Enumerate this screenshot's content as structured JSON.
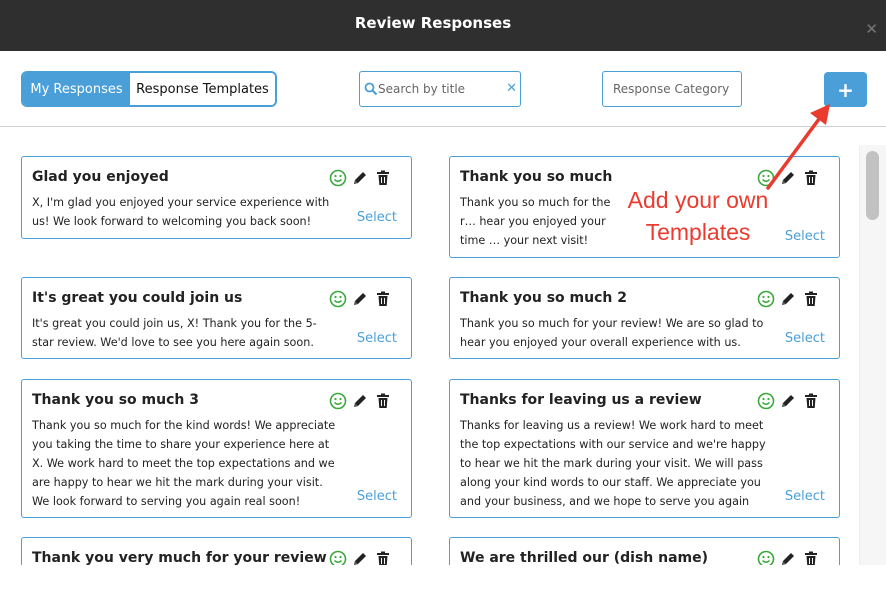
{
  "window": {
    "title": "Review Responses",
    "close_icon": "close-icon"
  },
  "toolbar": {
    "tabs": [
      {
        "label": "My Responses",
        "active": true
      },
      {
        "label": "Response Templates",
        "active": false
      }
    ],
    "search": {
      "placeholder": "Search by title",
      "value": ""
    },
    "category": {
      "placeholder": "Response Category"
    },
    "add_button": {
      "label": "+"
    }
  },
  "cards": [
    {
      "title": "Glad you enjoyed",
      "body": "X, I'm glad you enjoyed your service experience with us! We look forward to welcoming you back soon!",
      "select": "Select"
    },
    {
      "title": "Thank you so much",
      "body": "Thank you so much for the r… hear you enjoyed your time … your next visit! Thanks agai…",
      "select": "Select"
    },
    {
      "title": "It's great you could join us",
      "body": "It's great you could join us, X! Thank you for the 5-star review. We'd love to see you here again soon.",
      "select": "Select"
    },
    {
      "title": "Thank you so much 2",
      "body": "Thank you so much for your review! We are so glad to hear you enjoyed your overall experience with us.",
      "select": "Select"
    },
    {
      "title": "Thank you so much 3",
      "body": "Thank you so much for the kind words! We appreciate you taking the time to share your experience here at X. We work hard to meet the top expectations and we are happy to hear we hit the mark during your visit. We look forward to serving you again real soon!",
      "select": "Select"
    },
    {
      "title": "Thanks for leaving us a review",
      "body": "Thanks for leaving us a review! We work hard to meet the top expectations with our service and we're happy to hear we hit the mark during your visit. We will pass along your kind words to our staff. We appreciate you and your business, and we hope to serve you again soon!",
      "select": "Select"
    },
    {
      "title": "Thank you very much for your review",
      "body": "",
      "select": "Select"
    },
    {
      "title": "We are thrilled our (dish name)",
      "body": "",
      "select": "Select"
    }
  ],
  "annotation": {
    "line1": "Add your  own",
    "line2": "Templates",
    "color": "#ea3b2f"
  },
  "colors": {
    "accent": "#4a9fd8",
    "titlebar": "#2f2f2f",
    "smile": "#3aa93a"
  }
}
